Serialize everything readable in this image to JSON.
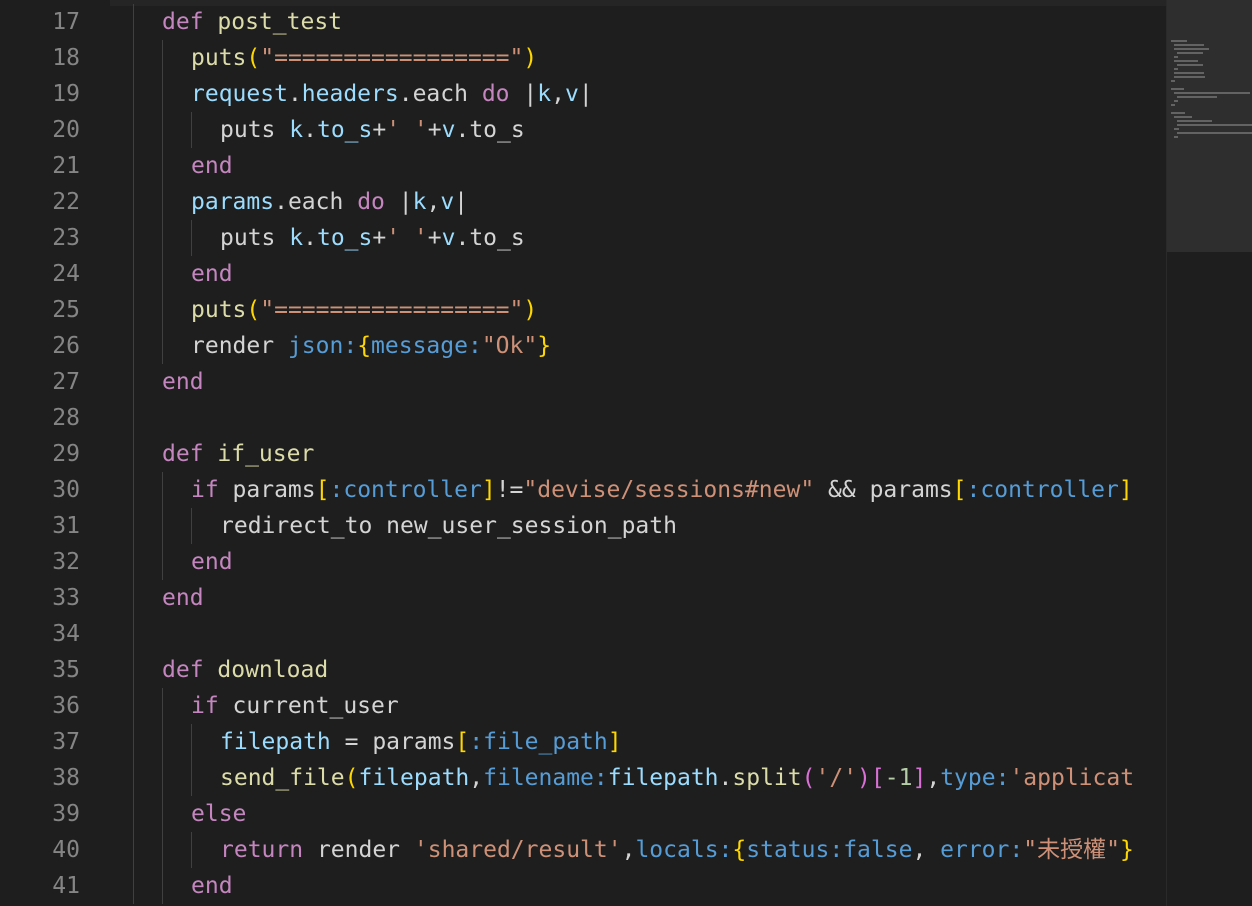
{
  "editor": {
    "lines": [
      {
        "n": "17",
        "indent": 0,
        "tokens": [
          [
            "kw",
            "def "
          ],
          [
            "fn",
            "post_test"
          ]
        ]
      },
      {
        "n": "18",
        "indent": 1,
        "tokens": [
          [
            "fn",
            "puts"
          ],
          [
            "brk",
            "("
          ],
          [
            "str",
            "\"=================\""
          ],
          [
            "brk",
            ")"
          ]
        ]
      },
      {
        "n": "19",
        "indent": 1,
        "tokens": [
          [
            "var",
            "request"
          ],
          [
            "plain",
            "."
          ],
          [
            "var",
            "headers"
          ],
          [
            "plain",
            ".each "
          ],
          [
            "kw",
            "do"
          ],
          [
            "plain",
            " |"
          ],
          [
            "var",
            "k"
          ],
          [
            "plain",
            ","
          ],
          [
            "var",
            "v"
          ],
          [
            "plain",
            "|"
          ]
        ]
      },
      {
        "n": "20",
        "indent": 2,
        "tokens": [
          [
            "plain",
            "puts "
          ],
          [
            "var",
            "k"
          ],
          [
            "plain",
            "."
          ],
          [
            "var",
            "to_s"
          ],
          [
            "plain",
            "+"
          ],
          [
            "str",
            "' '"
          ],
          [
            "plain",
            "+"
          ],
          [
            "var",
            "v"
          ],
          [
            "plain",
            ".to_s"
          ]
        ]
      },
      {
        "n": "21",
        "indent": 1,
        "tokens": [
          [
            "kw",
            "end"
          ]
        ]
      },
      {
        "n": "22",
        "indent": 1,
        "tokens": [
          [
            "var",
            "params"
          ],
          [
            "plain",
            ".each "
          ],
          [
            "kw",
            "do"
          ],
          [
            "plain",
            " |"
          ],
          [
            "var",
            "k"
          ],
          [
            "plain",
            ","
          ],
          [
            "var",
            "v"
          ],
          [
            "plain",
            "|"
          ]
        ]
      },
      {
        "n": "23",
        "indent": 2,
        "tokens": [
          [
            "plain",
            "puts "
          ],
          [
            "var",
            "k"
          ],
          [
            "plain",
            "."
          ],
          [
            "var",
            "to_s"
          ],
          [
            "plain",
            "+"
          ],
          [
            "str",
            "' '"
          ],
          [
            "plain",
            "+"
          ],
          [
            "var",
            "v"
          ],
          [
            "plain",
            ".to_s"
          ]
        ]
      },
      {
        "n": "24",
        "indent": 1,
        "tokens": [
          [
            "kw",
            "end"
          ]
        ]
      },
      {
        "n": "25",
        "indent": 1,
        "tokens": [
          [
            "fn",
            "puts"
          ],
          [
            "brk",
            "("
          ],
          [
            "str",
            "\"=================\""
          ],
          [
            "brk",
            ")"
          ]
        ]
      },
      {
        "n": "26",
        "indent": 1,
        "tokens": [
          [
            "plain",
            "render "
          ],
          [
            "sym",
            "json:"
          ],
          [
            "brk",
            "{"
          ],
          [
            "sym",
            "message:"
          ],
          [
            "str",
            "\"Ok\""
          ],
          [
            "brk",
            "}"
          ]
        ]
      },
      {
        "n": "27",
        "indent": 0,
        "tokens": [
          [
            "kw",
            "end"
          ]
        ]
      },
      {
        "n": "28",
        "indent": 0,
        "tokens": []
      },
      {
        "n": "29",
        "indent": 0,
        "tokens": [
          [
            "kw",
            "def "
          ],
          [
            "fn",
            "if_user"
          ]
        ]
      },
      {
        "n": "30",
        "indent": 1,
        "tokens": [
          [
            "kw",
            "if "
          ],
          [
            "plain",
            "params"
          ],
          [
            "brk",
            "["
          ],
          [
            "sym",
            ":controller"
          ],
          [
            "brk",
            "]"
          ],
          [
            "plain",
            "!="
          ],
          [
            "str",
            "\"devise/sessions#new\""
          ],
          [
            "plain",
            " && params"
          ],
          [
            "brk",
            "["
          ],
          [
            "sym",
            ":controller"
          ],
          [
            "brk",
            "]"
          ]
        ]
      },
      {
        "n": "31",
        "indent": 2,
        "tokens": [
          [
            "plain",
            "redirect_to new_user_session_path"
          ]
        ]
      },
      {
        "n": "32",
        "indent": 1,
        "tokens": [
          [
            "kw",
            "end"
          ]
        ]
      },
      {
        "n": "33",
        "indent": 0,
        "tokens": [
          [
            "kw",
            "end"
          ]
        ]
      },
      {
        "n": "34",
        "indent": 0,
        "tokens": []
      },
      {
        "n": "35",
        "indent": 0,
        "tokens": [
          [
            "kw",
            "def "
          ],
          [
            "fn",
            "download"
          ]
        ]
      },
      {
        "n": "36",
        "indent": 1,
        "tokens": [
          [
            "kw",
            "if "
          ],
          [
            "plain",
            "current_user"
          ]
        ]
      },
      {
        "n": "37",
        "indent": 2,
        "tokens": [
          [
            "var",
            "filepath"
          ],
          [
            "plain",
            " = params"
          ],
          [
            "brk",
            "["
          ],
          [
            "sym",
            ":file_path"
          ],
          [
            "brk",
            "]"
          ]
        ]
      },
      {
        "n": "38",
        "indent": 2,
        "tokens": [
          [
            "fn",
            "send_file"
          ],
          [
            "brk",
            "("
          ],
          [
            "var",
            "filepath"
          ],
          [
            "plain",
            ","
          ],
          [
            "sym",
            "filename:"
          ],
          [
            "var",
            "filepath"
          ],
          [
            "plain",
            "."
          ],
          [
            "fn",
            "split"
          ],
          [
            "brk2",
            "("
          ],
          [
            "str",
            "'/'"
          ],
          [
            "brk2",
            ")"
          ],
          [
            "brk2",
            "["
          ],
          [
            "num",
            "-1"
          ],
          [
            "brk2",
            "]"
          ],
          [
            "plain",
            ","
          ],
          [
            "sym",
            "type:"
          ],
          [
            "str",
            "'applicat"
          ]
        ]
      },
      {
        "n": "39",
        "indent": 1,
        "tokens": [
          [
            "kw",
            "else"
          ]
        ]
      },
      {
        "n": "40",
        "indent": 2,
        "tokens": [
          [
            "kw",
            "return "
          ],
          [
            "plain",
            "render "
          ],
          [
            "str",
            "'shared/result'"
          ],
          [
            "plain",
            ","
          ],
          [
            "sym",
            "locals:"
          ],
          [
            "brk",
            "{"
          ],
          [
            "sym",
            "status:"
          ],
          [
            "sym",
            "false"
          ],
          [
            "plain",
            ", "
          ],
          [
            "sym",
            "error:"
          ],
          [
            "str",
            "\"未授權\""
          ],
          [
            "brk",
            "}"
          ]
        ]
      },
      {
        "n": "41",
        "indent": 1,
        "tokens": [
          [
            "kw",
            "end"
          ]
        ]
      }
    ]
  },
  "colors": {
    "background": "#1e1e1e",
    "line_number": "#858585",
    "keyword": "#c586c0",
    "function": "#dcdcaa",
    "string": "#ce9178",
    "symbol": "#569cd6",
    "variable": "#9cdcfe",
    "bracket": "#ffd700"
  }
}
